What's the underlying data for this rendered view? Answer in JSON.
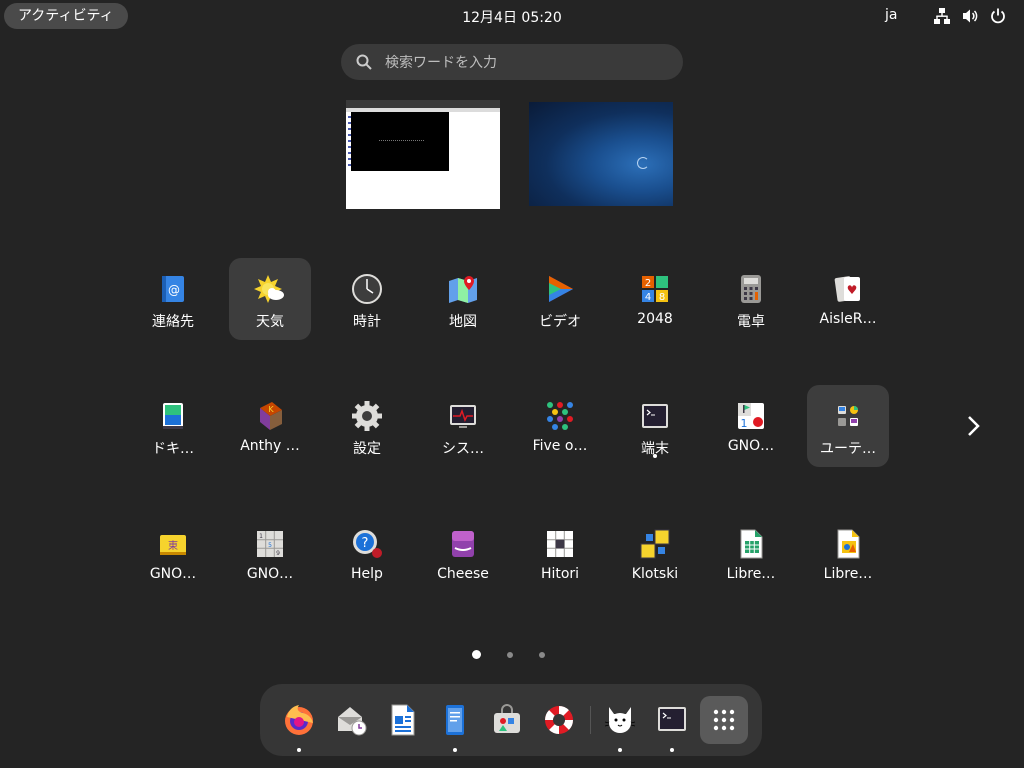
{
  "topbar": {
    "activities_label": "アクティビティ",
    "clock": "12月4日  05:20",
    "input_method": "ja"
  },
  "search": {
    "placeholder": "検索ワードを入力"
  },
  "apps": {
    "row1": [
      "連絡先",
      "天気",
      "時計",
      "地図",
      "ビデオ",
      "2048",
      "電卓",
      "AisleR…"
    ],
    "row2": [
      "ドキ…",
      "Anthy …",
      "設定",
      "シス…",
      "Five o…",
      "端末",
      "GNO…",
      "ユーテ…"
    ],
    "row3": [
      "GNO…",
      "GNO…",
      "Help",
      "Cheese",
      "Hitori",
      "Klotski",
      "Libre…",
      "Libre…"
    ],
    "icon_2048": [
      "2",
      "4",
      "8"
    ]
  },
  "pagination": {
    "current": 1,
    "total": 3
  },
  "dock": {
    "items": [
      "firefox",
      "evolution",
      "writer",
      "text-editor",
      "software",
      "help",
      "tux-paint",
      "terminal",
      "show-apps"
    ]
  },
  "colors": {
    "background": "#242424",
    "highlight": "#3d3d3d",
    "dock": "#363636"
  }
}
